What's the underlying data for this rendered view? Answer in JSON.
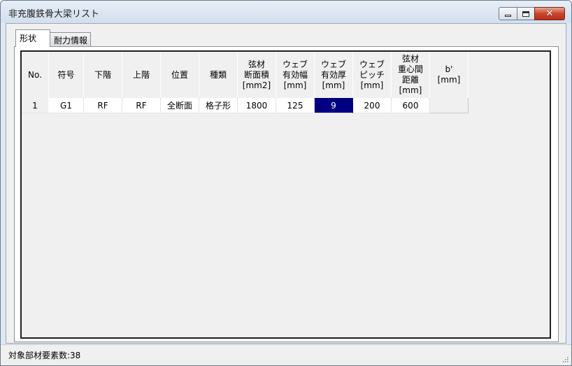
{
  "window": {
    "title": "非充腹鉄骨大梁リスト",
    "minimize_icon": "minimize-icon",
    "maximize_icon": "maximize-icon",
    "close_icon": "close-icon",
    "close_color": "#c8452c"
  },
  "tabs": [
    {
      "label": "形状",
      "active": true
    },
    {
      "label": "耐力情報",
      "active": false
    }
  ],
  "grid": {
    "columns": [
      {
        "label": "No."
      },
      {
        "label": "符号"
      },
      {
        "label": "下階"
      },
      {
        "label": "上階"
      },
      {
        "label": "位置"
      },
      {
        "label": "種類"
      },
      {
        "label": "弦材\n断面積\n[mm2]"
      },
      {
        "label": "ウェブ\n有効幅\n[mm]"
      },
      {
        "label": "ウェブ\n有効厚\n[mm]"
      },
      {
        "label": "ウェブ\nピッチ\n[mm]"
      },
      {
        "label": "弦材\n重心間\n距離\n[mm]"
      },
      {
        "label": "b'\n[mm]"
      }
    ],
    "rows": [
      [
        "1",
        "G1",
        "RF",
        "RF",
        "全断面",
        "格子形",
        "1800",
        "125",
        "9",
        "200",
        "600",
        ""
      ]
    ],
    "selected": {
      "row": 0,
      "col": 8
    },
    "selection_color": "#000080"
  },
  "status": {
    "text": "対象部材要素数:38"
  }
}
